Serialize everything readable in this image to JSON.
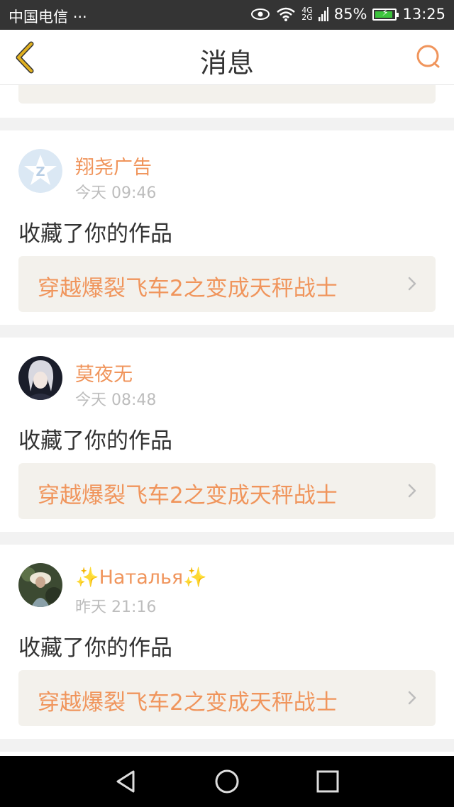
{
  "status_bar": {
    "carrier": "中国电信",
    "more": "···",
    "network_top": "4G",
    "network_bottom": "2G",
    "battery": "85%",
    "time": "13:25"
  },
  "header": {
    "title": "消息"
  },
  "messages": [
    {
      "username": "翔尧广告",
      "time": "今天 09:46",
      "action": "收藏了你的作品",
      "work_title": "穿越爆裂飞车2之变成天秤战士"
    },
    {
      "username": "莫夜无",
      "time": "今天 08:48",
      "action": "收藏了你的作品",
      "work_title": "穿越爆裂飞车2之变成天秤战士"
    },
    {
      "username": "✨Наталья✨",
      "time": "昨天 21:16",
      "action": "收藏了你的作品",
      "work_title": "穿越爆裂飞车2之变成天秤战士"
    }
  ],
  "colors": {
    "accent": "#f0955c",
    "back_arrow": "#e0b020",
    "link_bg": "#f3f1ec"
  }
}
